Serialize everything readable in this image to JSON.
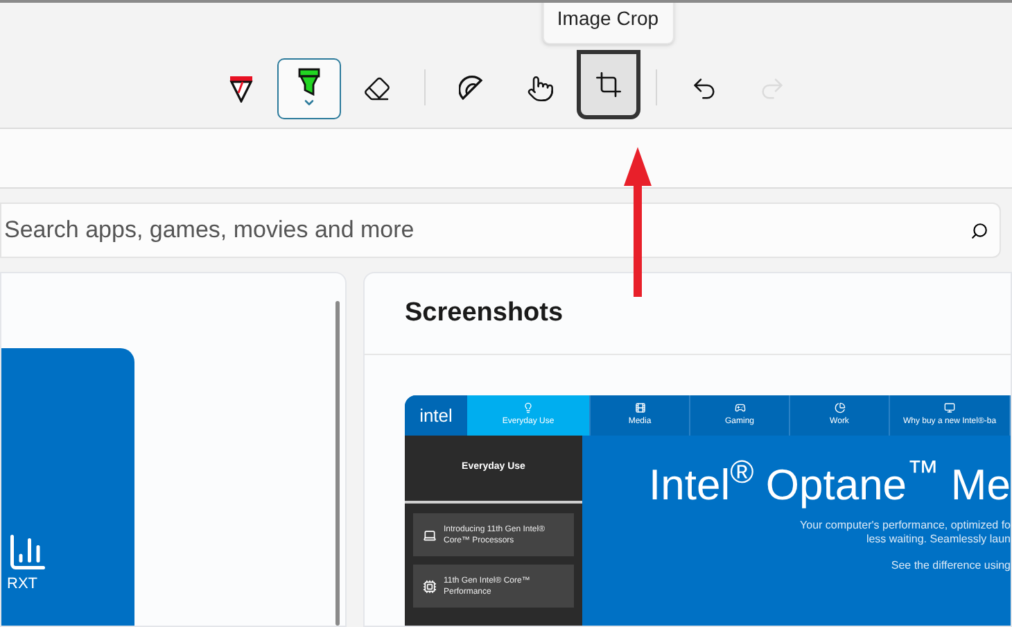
{
  "toolbar": {
    "groups": [
      [
        {
          "kind": "pen",
          "selected": false,
          "pressed": false,
          "disabled": false
        },
        {
          "kind": "highlighter",
          "selected": true,
          "pressed": false,
          "disabled": false
        },
        {
          "kind": "eraser",
          "selected": false,
          "pressed": false,
          "disabled": false
        }
      ],
      [
        {
          "kind": "protractor",
          "selected": false,
          "pressed": false,
          "disabled": false
        },
        {
          "kind": "touch",
          "selected": false,
          "pressed": false,
          "disabled": false
        },
        {
          "kind": "crop",
          "selected": false,
          "pressed": true,
          "disabled": false
        }
      ],
      [
        {
          "kind": "undo",
          "selected": false,
          "pressed": false,
          "disabled": false
        },
        {
          "kind": "redo",
          "selected": false,
          "pressed": false,
          "disabled": true
        }
      ]
    ],
    "tooltip": "Image Crop"
  },
  "search": {
    "placeholder": "Search apps, games, movies and more"
  },
  "left_card": {
    "tile_text": "RXT"
  },
  "screenshots": {
    "title": "Screenshots",
    "app": {
      "logo": "intel",
      "tabs": [
        {
          "label": "Everyday Use",
          "selected": true
        },
        {
          "label": "Media",
          "selected": false
        },
        {
          "label": "Gaming",
          "selected": false
        },
        {
          "label": "Work",
          "selected": false
        },
        {
          "label": "Why buy a new Intel®-ba",
          "selected": false
        }
      ],
      "sidebar_title": "Everyday Use",
      "sidebar_items": [
        {
          "label": "Introducing 11th Gen Intel® Core™ Processors"
        },
        {
          "label": "11th Gen Intel® Core™ Performance"
        }
      ],
      "heading": "Intel$^{®}$ Optane$^{™}$ Me",
      "lines": [
        "Your computer's performance, optimized fo",
        "less waiting. Seamlessly laun"
      ],
      "link_line": "See the difference using"
    }
  }
}
